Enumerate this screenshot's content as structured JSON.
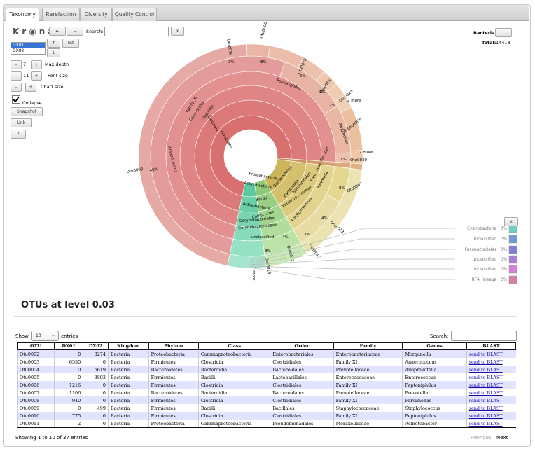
{
  "tabs": [
    {
      "label": "Taxonomy"
    },
    {
      "label": "Rarefaction"
    },
    {
      "label": "Diversity"
    },
    {
      "label": "Quality Control"
    }
  ],
  "krona": {
    "logo": "Kr◉na",
    "search_label": "Search:",
    "search_clear": "x",
    "back_button": "←",
    "forward_button": "→",
    "dataset_up": "↑",
    "dataset_down": "↓",
    "list_button": "list",
    "datasets": [
      "DX01",
      "DX02"
    ],
    "max_depth_label": "Max depth",
    "max_depth_value": "7",
    "font_size_label": "Font size",
    "font_size_value": "11",
    "chart_size_label": "Chart size",
    "minus": "-",
    "plus": "+",
    "collapse_label": "Collapse",
    "snapshot_button": "Snapshot",
    "link_button": "Link",
    "help_button": "?",
    "focus_name": "Bacteria",
    "total_label": "Total:",
    "total_value": "14418",
    "legend_close": "x",
    "legend_items": [
      {
        "label": "Cyanobacteria",
        "pct": "0%",
        "color": "#6fcfc4"
      },
      {
        "label": "unclassified",
        "pct": "0%",
        "color": "#6f9ad6"
      },
      {
        "label": "Fusobacteriales",
        "pct": "0%",
        "color": "#7f7fd6"
      },
      {
        "label": "unclassified",
        "pct": "0%",
        "color": "#a77fd6"
      },
      {
        "label": "unclassified",
        "pct": "0%",
        "color": "#d67fd6"
      },
      {
        "label": "RF4_lineage",
        "pct": "0%",
        "color": "#d67fa8"
      }
    ],
    "center_label": "Bacteria",
    "wedge_labels": {
      "firmicutes": "Firmicutes",
      "clostridia1": "Clostridia",
      "clostridia2": "Clostridia",
      "clostridiales": "Clostridiales",
      "family_xi": "Family_XI",
      "anaerococcus": "Anaerococcus",
      "otu0003": "Otu0003",
      "otu0003_pct": "45%",
      "peptoniphilus": "Peptoniphilus",
      "parvimonas": "Parvimonas",
      "otu0008": "Otu0008",
      "otu0008_pct": "7%",
      "otu0019": "Otu0019",
      "otu0019_pct": "3%",
      "otu0006": "Otu0006",
      "otu0006_pct": "8%",
      "otu0010": "Otu0010",
      "otu0010_pct": "5%",
      "otu0016": "Otu0016",
      "otu0016_pct": "3%",
      "otu0024": "Otu0024",
      "otu0024_pct": "2%",
      "two_more_a": "2 more",
      "two_more_b": "2 more",
      "otu0030": "Otu0030",
      "otu0030_pct": "1%",
      "proteobacteria": "Proteobacteria",
      "actinobacteria1": "Actinobacteria",
      "actinobacteria2": "Actinobacteria",
      "bacteroidetes": "Bacteroidetes",
      "bacteroidia": "Bacteroidia",
      "bacteroidales": "Bacteroidales",
      "porphyro": "Porphyro...naceae",
      "prevotella": "Prevotella",
      "porphyromonas": "Porphyromonas",
      "otu0007": "Otu0007",
      "otu0007_pct": "8%",
      "otu0013": "Otu0013",
      "otu0013_pct": "4%",
      "otu0015": "Otu0015",
      "otu0015_pct": "3%",
      "prev_por": "Prev...ceae Por...ces",
      "bacilli": "Bacilli ...",
      "camp": "Camp...cter",
      "coryne1": "Corynebacteriales",
      "coryne2": "Corynebacteriaceae",
      "unclassified": "unclassified",
      "otu0012": "Otu0012",
      "otu0012_pct": "4%",
      "otu0014": "Otu0014",
      "otu0014_pct": "3%",
      "one_more": "1 more"
    }
  },
  "section_title": "OTUs at level 0.03",
  "table_controls": {
    "show_label": "Show",
    "show_value": "10",
    "entries_label": "entries",
    "search_label": "Search:"
  },
  "table": {
    "columns": [
      "OTU",
      "DX01",
      "DX02",
      "Kingdom",
      "Phylum",
      "Class",
      "Order",
      "Family",
      "Genus",
      "BLAST"
    ],
    "rows": [
      [
        "Otu0002",
        "0",
        "8274",
        "Bacteria",
        "Proteobacteria",
        "Gammaproteobacteria",
        "Enterobacteriales",
        "Enterobacteriaceae",
        "Morganella",
        "send to BLAST"
      ],
      [
        "Otu0003",
        "6550",
        "0",
        "Bacteria",
        "Firmicutes",
        "Clostridia",
        "Clostridiales",
        "Family XI",
        "Anaerococcus",
        "send to BLAST"
      ],
      [
        "Otu0004",
        "0",
        "6619",
        "Bacteria",
        "Bacteroidetes",
        "Bacteroidia",
        "Bacteroidales",
        "Prevotellaceae",
        "Alloprevotella",
        "send to BLAST"
      ],
      [
        "Otu0005",
        "0",
        "3892",
        "Bacteria",
        "Firmicutes",
        "Bacilli",
        "Lactobacillales",
        "Enterococcaceae",
        "Enterococcus",
        "send to BLAST"
      ],
      [
        "Otu0006",
        "1216",
        "0",
        "Bacteria",
        "Firmicutes",
        "Clostridia",
        "Clostridiales",
        "Family XI",
        "Peptoniphilus",
        "send to BLAST"
      ],
      [
        "Otu0007",
        "1106",
        "0",
        "Bacteria",
        "Bacteroidetes",
        "Bacteroidia",
        "Bacteroidales",
        "Prevotellaceae",
        "Prevotella",
        "send to BLAST"
      ],
      [
        "Otu0008",
        "940",
        "0",
        "Bacteria",
        "Firmicutes",
        "Clostridia",
        "Clostridiales",
        "Family XI",
        "Parvimonas",
        "send to BLAST"
      ],
      [
        "Otu0009",
        "0",
        "499",
        "Bacteria",
        "Firmicutes",
        "Bacilli",
        "Bacillales",
        "Staphylococcaceae",
        "Staphylococcus",
        "send to BLAST"
      ],
      [
        "Otu0010",
        "775",
        "0",
        "Bacteria",
        "Firmicutes",
        "Clostridia",
        "Clostridiales",
        "Family XI",
        "Peptoniphilus",
        "send to BLAST"
      ],
      [
        "Otu0011",
        "2",
        "0",
        "Bacteria",
        "Proteobacteria",
        "Gammaproteobacteria",
        "Pseudomonadales",
        "Moraxellaceae",
        "Acinetobacter",
        "send to BLAST"
      ]
    ]
  },
  "footer": {
    "info": "Showing 1 to 10 of 37 entries",
    "previous": "Previous",
    "next": "Next"
  }
}
